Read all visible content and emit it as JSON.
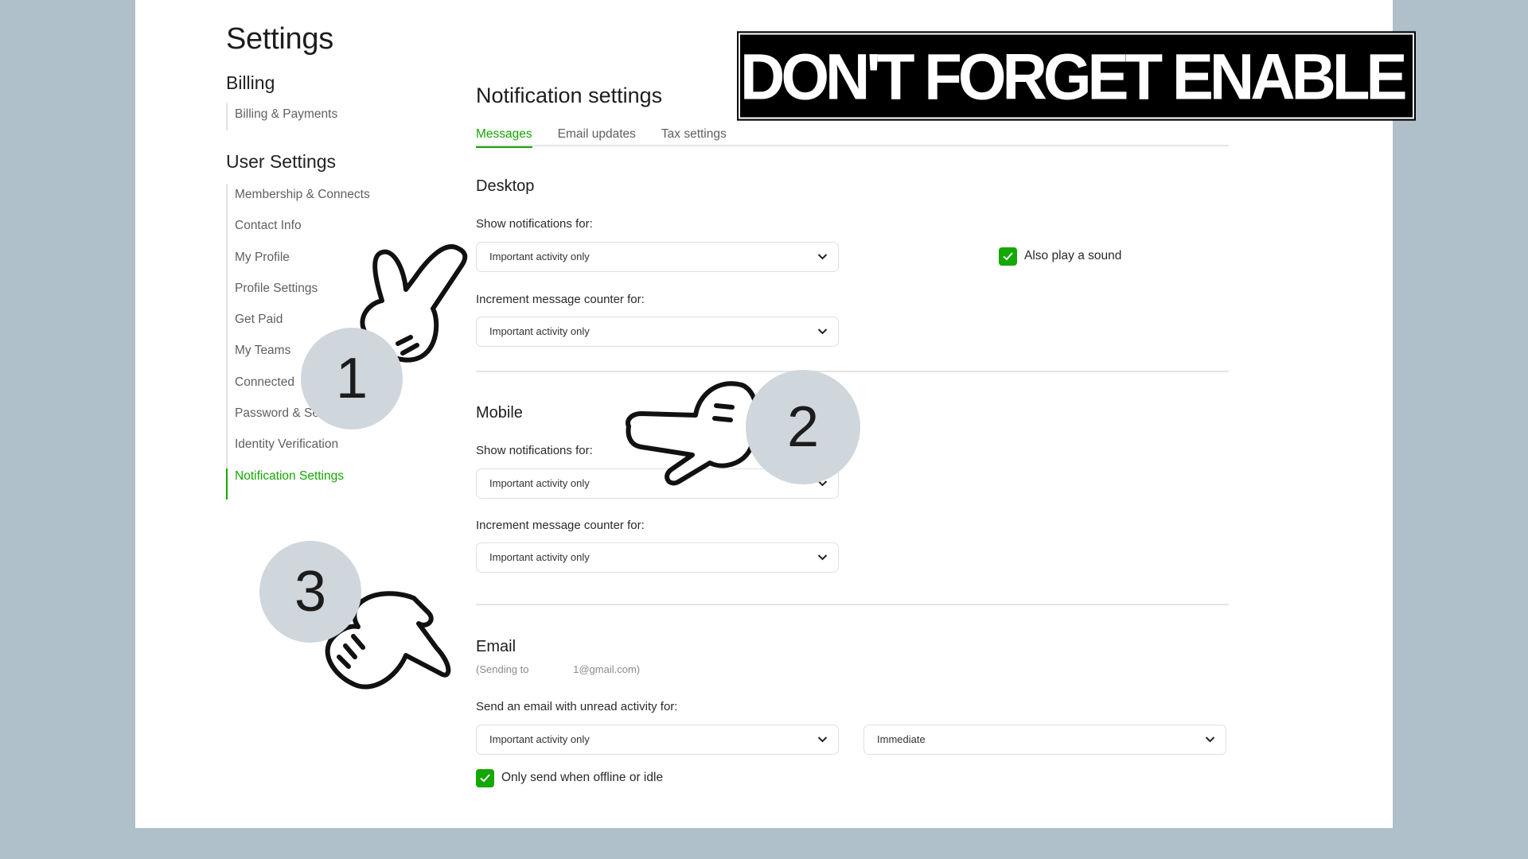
{
  "nav": {
    "title": "Settings",
    "billing_title": "Billing",
    "billing_items": [
      "Billing & Payments"
    ],
    "user_title": "User Settings",
    "user_items": [
      "Membership & Connects",
      "Contact Info",
      "My Profile",
      "Profile Settings",
      "Get Paid",
      "My Teams",
      "Connected",
      "Password & Se",
      "Identity Verification",
      "Notification Settings"
    ],
    "active_item": "Notification Settings"
  },
  "main": {
    "title": "Notification settings",
    "tabs": [
      "Messages",
      "Email updates",
      "Tax settings"
    ],
    "active_tab": "Messages",
    "desktop": {
      "title": "Desktop",
      "show_label": "Show notifications for:",
      "show_value": "Important activity only",
      "sound_label": "Also play a sound",
      "sound_checked": true,
      "counter_label": "Increment message counter for:",
      "counter_value": "Important activity only"
    },
    "mobile": {
      "title": "Mobile",
      "show_label": "Show notifications for:",
      "show_value": "Important activity only",
      "counter_label": "Increment message counter for:",
      "counter_value": "Important activity only"
    },
    "email": {
      "title": "Email",
      "sending_prefix": "(Sending to",
      "sending_address": "1@gmail.com)",
      "unread_label": "Send an email with unread activity for:",
      "unread_value": "Important activity only",
      "frequency_value": "Immediate",
      "offline_label": "Only send when offline or idle",
      "offline_checked": true
    }
  },
  "overlay": {
    "banner": "DON'T FORGET ENABLE NOTIFICATION",
    "steps": [
      "1",
      "2",
      "3"
    ]
  },
  "colors": {
    "accent": "#14a800",
    "background": "#b0c0cb",
    "badge": "#cfd6dc"
  }
}
